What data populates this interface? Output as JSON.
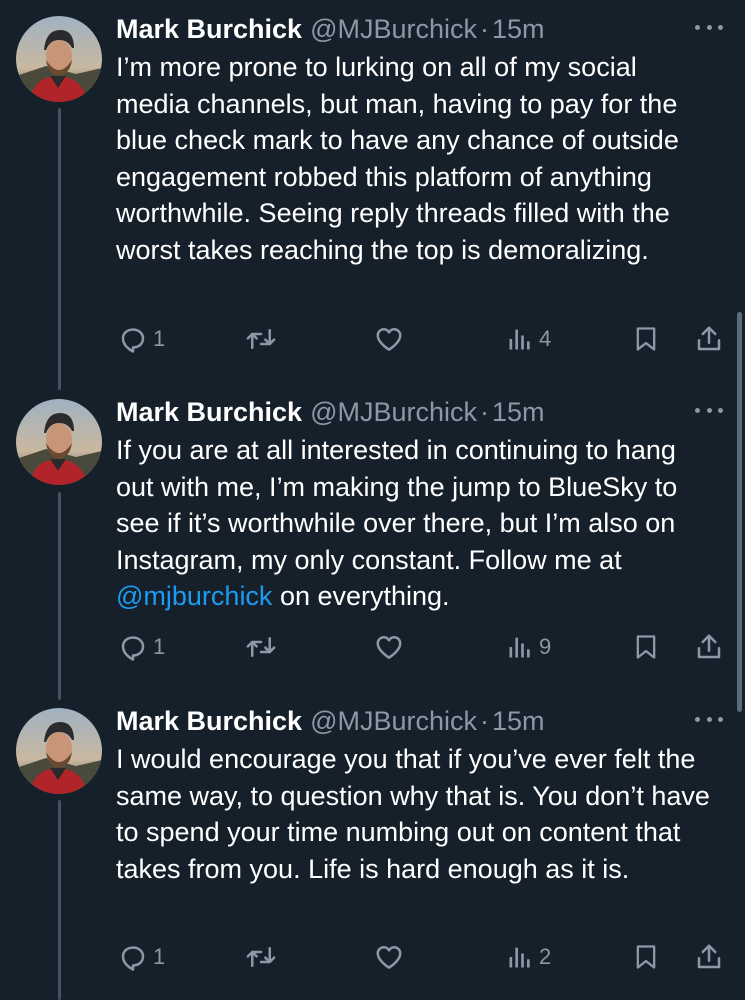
{
  "author": {
    "name": "Mark Burchick",
    "handle": "@MJBurchick",
    "separator": "·"
  },
  "colors": {
    "background": "#15202b",
    "text": "#ffffff",
    "muted": "#8b98a5",
    "link": "#1d9bf0"
  },
  "tweets": [
    {
      "time": "15m",
      "text": "I’m more prone to lurking on all of my social media channels, but man, having to pay for the blue check mark to have any chance of outside  engagement robbed this platform of anything worthwhile. Seeing reply threads filled with the worst takes reaching the top is demoralizing.",
      "replies": "1",
      "views": "4",
      "icons": [
        "reply-icon",
        "retweet-icon",
        "like-icon",
        "views-icon",
        "bookmark-icon",
        "share-icon"
      ]
    },
    {
      "time": "15m",
      "text_before": "If you are at all interested in continuing to hang out with me, I’m making the jump to BlueSky to see if it’s worthwhile over there, but I’m also on Instagram, my only constant. Follow me at ",
      "mention": "@mjburchick",
      "text_after": " on everything.",
      "replies": "1",
      "views": "9",
      "icons": [
        "reply-icon",
        "retweet-icon",
        "like-icon",
        "views-icon",
        "bookmark-icon",
        "share-icon"
      ]
    },
    {
      "time": "15m",
      "text": "I would encourage you that if you’ve ever felt the same way, to question why that is. You don’t have to spend your time numbing out on content that takes from you. Life is hard enough as it is.",
      "replies": "1",
      "views": "2",
      "icons": [
        "reply-icon",
        "retweet-icon",
        "like-icon",
        "views-icon",
        "bookmark-icon",
        "share-icon"
      ]
    }
  ]
}
